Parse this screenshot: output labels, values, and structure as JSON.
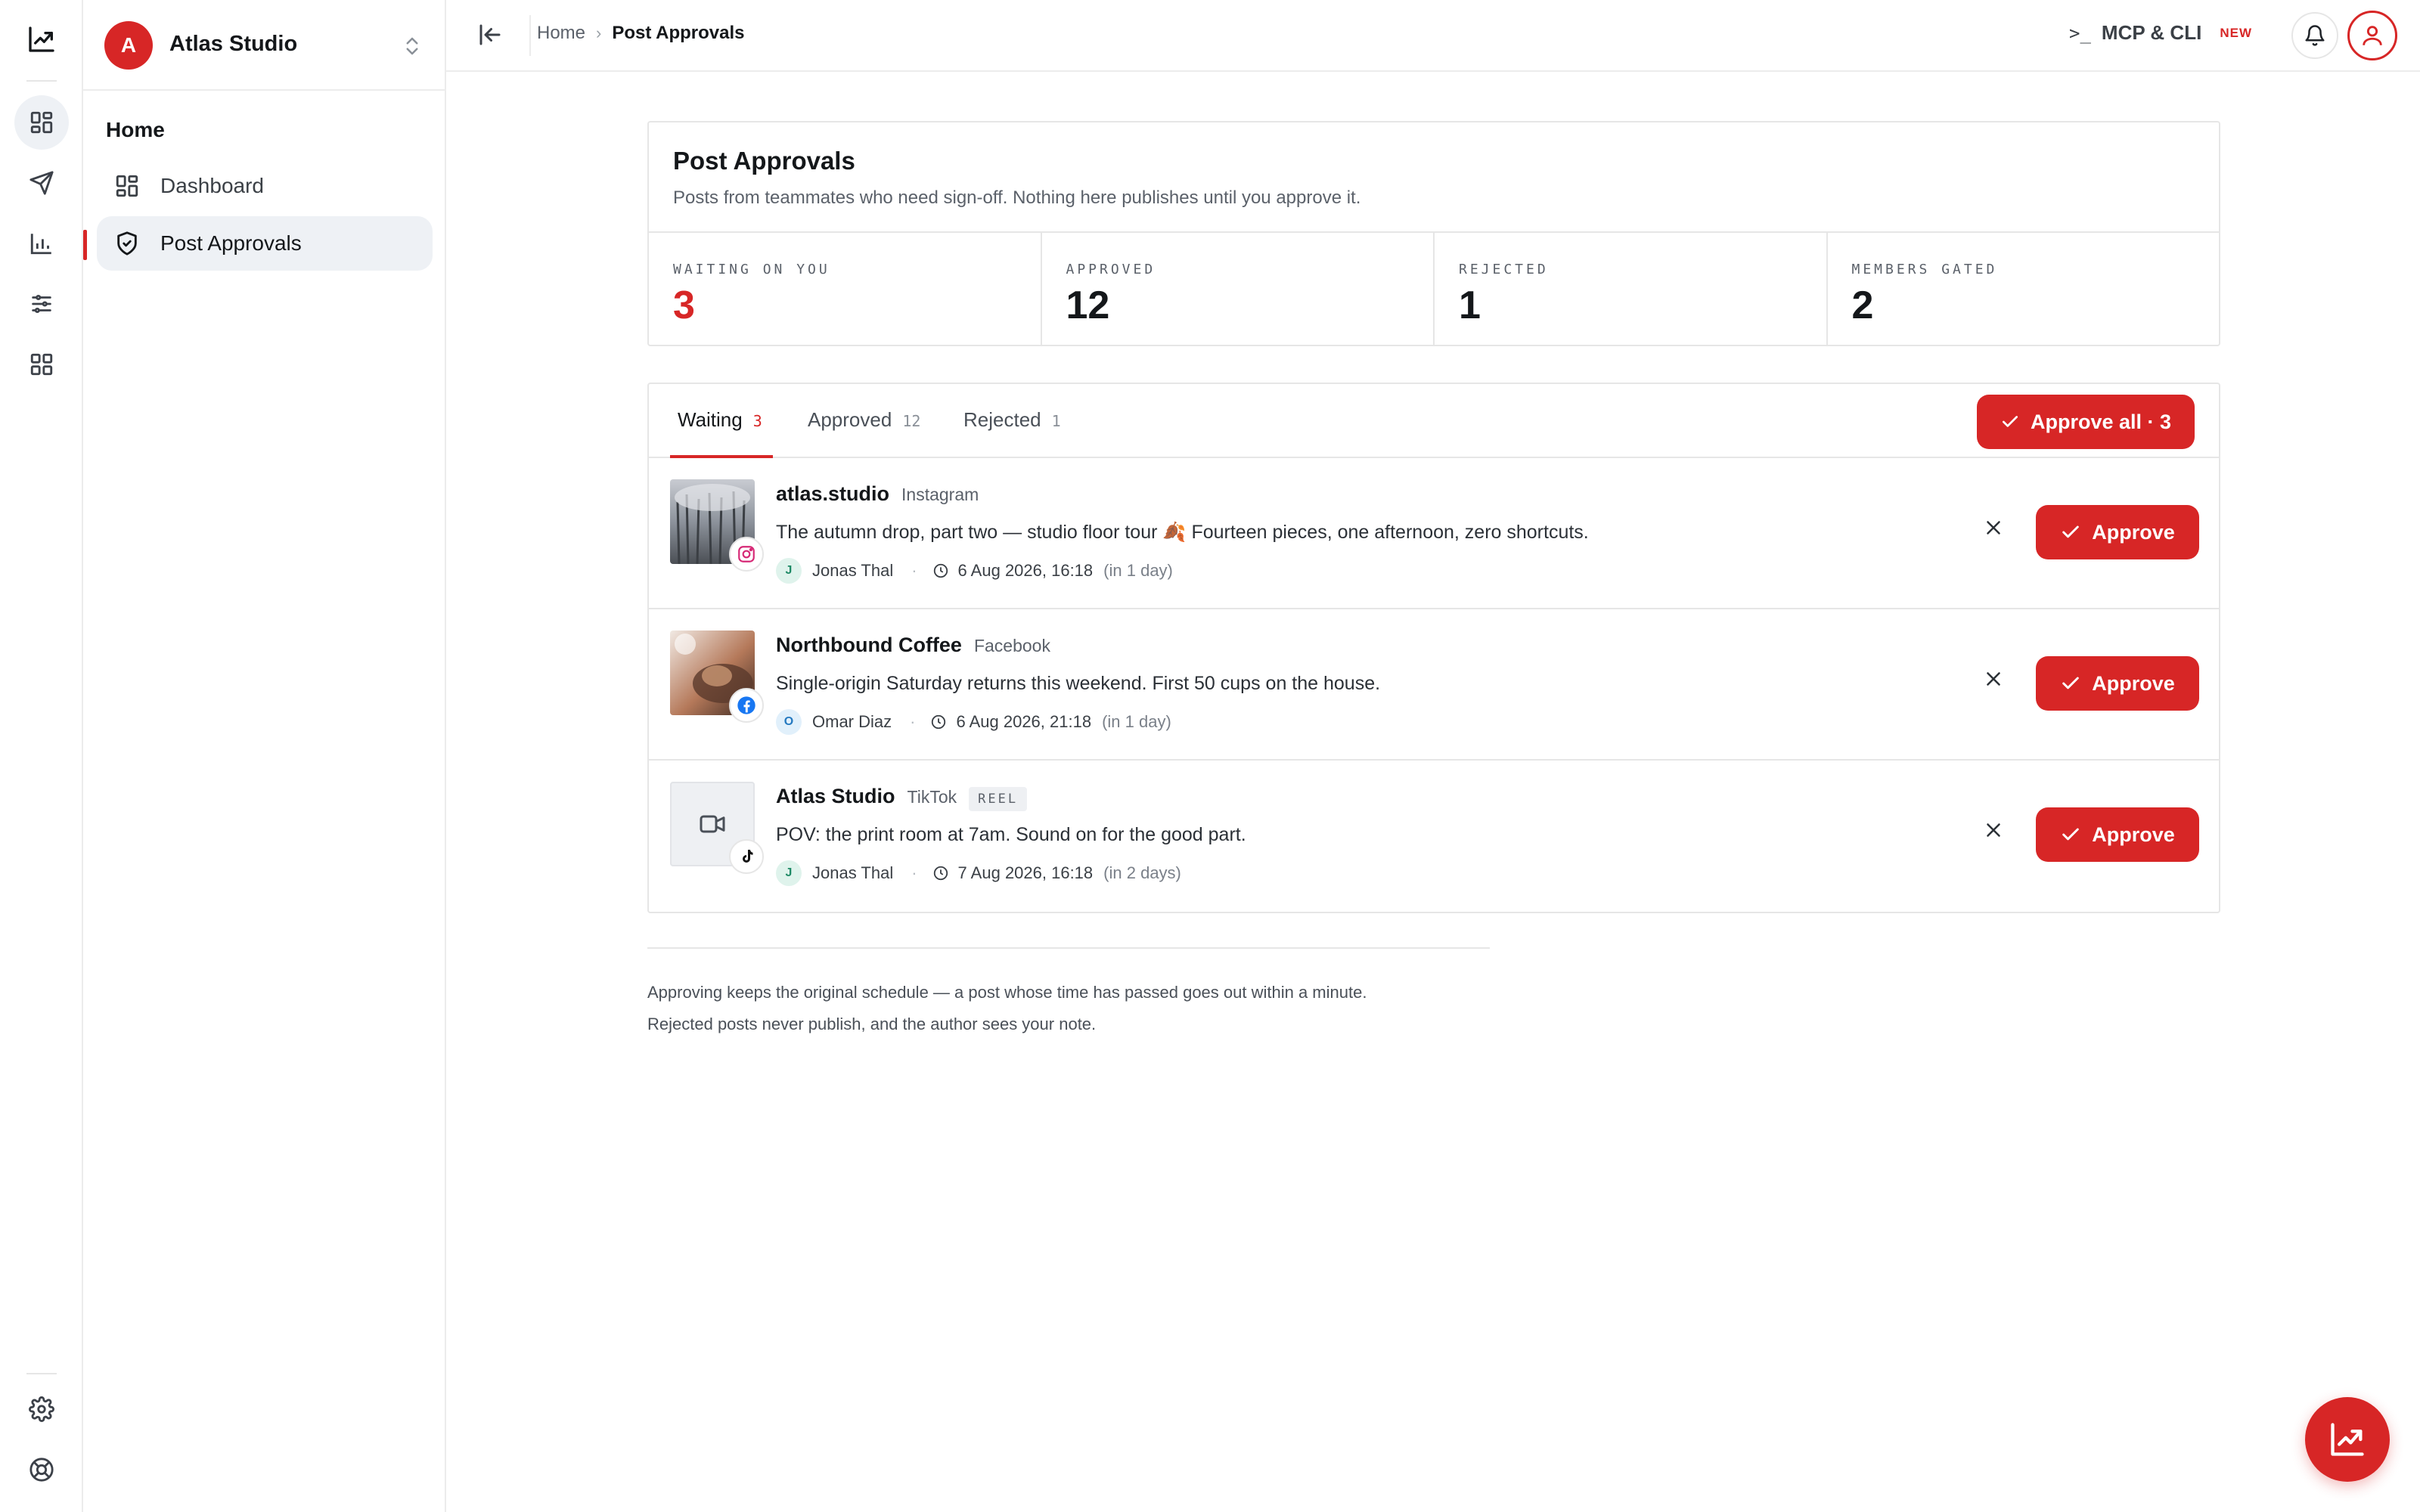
{
  "workspace": {
    "initial": "A",
    "name": "Atlas Studio"
  },
  "sidebar": {
    "section": "Home",
    "items": [
      {
        "label": "Dashboard"
      },
      {
        "label": "Post Approvals"
      }
    ]
  },
  "breadcrumb": {
    "home": "Home",
    "current": "Post Approvals"
  },
  "topbar": {
    "mcp_prompt": ">_",
    "mcp_label": "MCP & CLI",
    "mcp_badge": "NEW"
  },
  "header": {
    "title": "Post Approvals",
    "subtitle": "Posts from teammates who need sign-off. Nothing here publishes until you approve it."
  },
  "stats": [
    {
      "label": "WAITING ON YOU",
      "value": "3"
    },
    {
      "label": "APPROVED",
      "value": "12"
    },
    {
      "label": "REJECTED",
      "value": "1"
    },
    {
      "label": "MEMBERS GATED",
      "value": "2"
    }
  ],
  "tabs": [
    {
      "label": "Waiting",
      "count": "3"
    },
    {
      "label": "Approved",
      "count": "12"
    },
    {
      "label": "Rejected",
      "count": "1"
    }
  ],
  "approve_all_label": "Approve all · 3",
  "posts": [
    {
      "account": "atlas.studio",
      "network": "Instagram",
      "text": "The autumn drop, part two — studio floor tour 🍂 Fourteen pieces, one afternoon, zero shortcuts.",
      "author_initial": "J",
      "author": "Jonas Thal",
      "when": "6 Aug 2026, 16:18",
      "relative": "(in 1 day)",
      "approve_label": "Approve"
    },
    {
      "account": "Northbound Coffee",
      "network": "Facebook",
      "text": "Single-origin Saturday returns this weekend. First 50 cups on the house.",
      "author_initial": "O",
      "author": "Omar Diaz",
      "when": "6 Aug 2026, 21:18",
      "relative": "(in 1 day)",
      "approve_label": "Approve"
    },
    {
      "account": "Atlas Studio",
      "network": "TikTok",
      "tag": "REEL",
      "text": "POV: the print room at 7am. Sound on for the good part.",
      "author_initial": "J",
      "author": "Jonas Thal",
      "when": "7 Aug 2026, 16:18",
      "relative": "(in 2 days)",
      "approve_label": "Approve"
    }
  ],
  "footer": {
    "line1": "Approving keeps the original schedule — a post whose time has passed goes out within a minute.",
    "line2": "Rejected posts never publish, and the author sees your note."
  },
  "colors": {
    "accent": "#d72626",
    "border": "#e6e6e6",
    "active_bg": "#eef1f5"
  }
}
